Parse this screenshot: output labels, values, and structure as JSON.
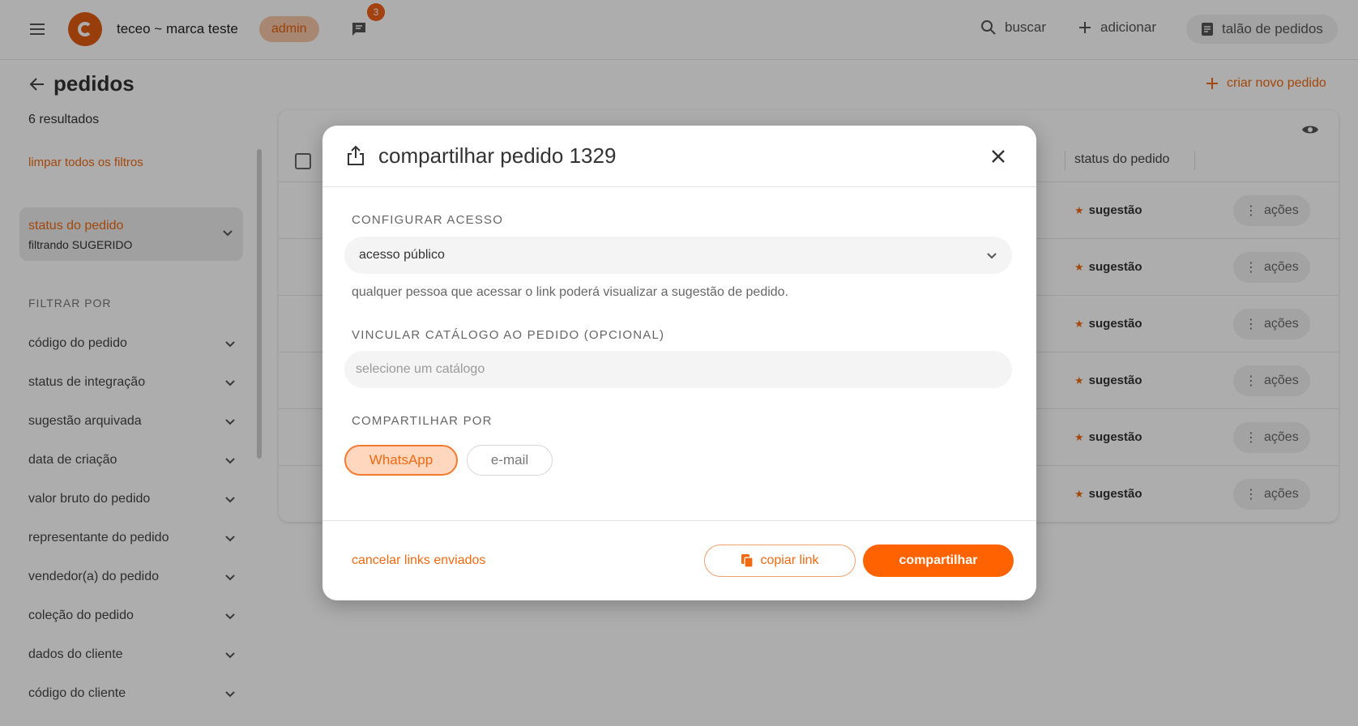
{
  "topbar": {
    "brand": "teceo ~ marca teste",
    "role": "admin",
    "notifications": "3",
    "search_label": "buscar",
    "add_label": "adicionar",
    "orderbook_label": "talão de pedidos"
  },
  "page": {
    "title": "pedidos",
    "results": "6 resultados",
    "clear_filters": "limpar todos os filtros",
    "new_order": "criar novo pedido"
  },
  "active_filter": {
    "title": "status do pedido",
    "subtitle": "filtrando SUGERIDO"
  },
  "sidebar": {
    "filter_by": "FILTRAR POR",
    "filters": [
      "código do pedido",
      "status de integração",
      "sugestão arquivada",
      "data de criação",
      "valor bruto do pedido",
      "representante do pedido",
      "vendedor(a) do pedido",
      "coleção do pedido",
      "dados do cliente",
      "código do cliente"
    ]
  },
  "table": {
    "status_header": "status do pedido",
    "rows": [
      {
        "status": "sugestão",
        "actions": "ações"
      },
      {
        "status": "sugestão",
        "actions": "ações"
      },
      {
        "status": "sugestão",
        "actions": "ações"
      },
      {
        "status": "sugestão",
        "actions": "ações"
      },
      {
        "status": "sugestão",
        "actions": "ações"
      },
      {
        "status": "sugestão",
        "actions": "ações"
      }
    ]
  },
  "modal": {
    "title": "compartilhar pedido 1329",
    "access_label": "CONFIGURAR ACESSO",
    "access_value": "acesso público",
    "access_help": "qualquer pessoa que acessar o link poderá visualizar a sugestão de pedido.",
    "catalog_label": "VINCULAR CATÁLOGO AO PEDIDO (OPCIONAL)",
    "catalog_placeholder": "selecione um catálogo",
    "share_by_label": "COMPARTILHAR POR",
    "channels": [
      "WhatsApp",
      "e-mail"
    ],
    "cancel_links": "cancelar links enviados",
    "copy_link": "copiar link",
    "share": "compartilhar"
  },
  "colors": {
    "accent": "#ff6200",
    "accent_soft": "#ffd7be"
  }
}
